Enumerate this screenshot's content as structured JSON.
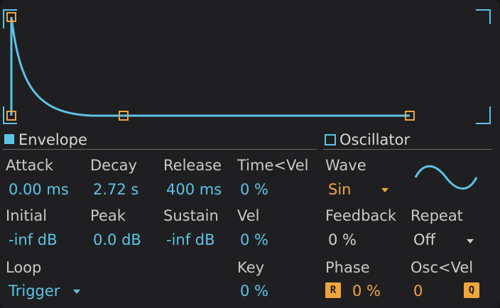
{
  "envelope": {
    "title": "Envelope",
    "params": {
      "attack": {
        "label": "Attack",
        "value": "0.00 ms"
      },
      "decay": {
        "label": "Decay",
        "value": "2.72 s"
      },
      "release": {
        "label": "Release",
        "value": "400 ms"
      },
      "time_vel": {
        "label": "Time<Vel",
        "value": "0 %"
      },
      "initial": {
        "label": "Initial",
        "value": "-inf dB"
      },
      "peak": {
        "label": "Peak",
        "value": "0.0 dB"
      },
      "sustain": {
        "label": "Sustain",
        "value": "-inf dB"
      },
      "vel": {
        "label": "Vel",
        "value": "0 %"
      },
      "loop": {
        "label": "Loop",
        "value": "Trigger"
      },
      "key": {
        "label": "Key",
        "value": "0 %"
      }
    }
  },
  "oscillator": {
    "title": "Oscillator",
    "params": {
      "wave": {
        "label": "Wave",
        "value": "Sin"
      },
      "feedback": {
        "label": "Feedback",
        "value": "0 %"
      },
      "repeat": {
        "label": "Repeat",
        "value": "Off"
      },
      "phase": {
        "label": "Phase",
        "value": "0 %",
        "retrigger_button": "R"
      },
      "osc_vel": {
        "label": "Osc<Vel",
        "value": "0",
        "quantize_button": "Q"
      }
    }
  },
  "colors": {
    "background": "#1f1f21",
    "accent_blue": "#5cc3e6",
    "accent_orange": "#f0a53c",
    "label_gray": "#c9c9c9"
  },
  "icons": {
    "envelope_toggle": "filled-square-icon",
    "oscillator_toggle": "outline-square-icon",
    "wave_preview": "sine-wave-icon",
    "dropdown": "triangle-down-icon"
  }
}
